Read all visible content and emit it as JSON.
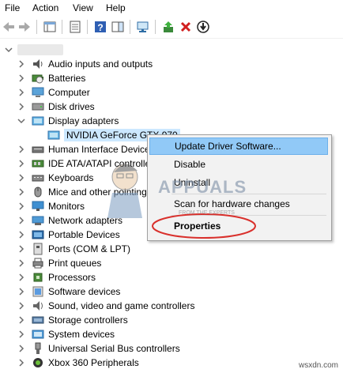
{
  "menu": [
    "File",
    "Action",
    "View",
    "Help"
  ],
  "toolbar_icons": [
    "back-arrow-icon",
    "forward-arrow-icon",
    "show-hide-console-icon",
    "properties-icon",
    "help-icon",
    "action-pane-icon",
    "scan-hardware-icon",
    "update-driver-icon",
    "uninstall-x-icon",
    "disable-device-icon"
  ],
  "tree": {
    "root_label": "",
    "items": [
      {
        "label": "Audio inputs and outputs",
        "icon": "speaker-icon",
        "expanded": false
      },
      {
        "label": "Batteries",
        "icon": "battery-icon",
        "expanded": false
      },
      {
        "label": "Computer",
        "icon": "computer-icon",
        "expanded": false
      },
      {
        "label": "Disk drives",
        "icon": "disk-drive-icon",
        "expanded": false
      },
      {
        "label": "Display adapters",
        "icon": "display-adapter-icon",
        "expanded": true
      },
      {
        "label": "NVIDIA GeForce GTX 970",
        "icon": "display-adapter-icon",
        "child": true
      },
      {
        "label": "Human Interface Device",
        "icon": "hid-icon",
        "expanded": false
      },
      {
        "label": "IDE ATA/ATAPI controlle",
        "icon": "ide-controller-icon",
        "expanded": false
      },
      {
        "label": "Keyboards",
        "icon": "keyboard-icon",
        "expanded": false
      },
      {
        "label": "Mice and other pointing",
        "icon": "mouse-icon",
        "expanded": false
      },
      {
        "label": "Monitors",
        "icon": "monitor-icon",
        "expanded": false
      },
      {
        "label": "Network adapters",
        "icon": "network-adapter-icon",
        "expanded": false
      },
      {
        "label": "Portable Devices",
        "icon": "portable-device-icon",
        "expanded": false
      },
      {
        "label": "Ports (COM & LPT)",
        "icon": "port-icon",
        "expanded": false
      },
      {
        "label": "Print queues",
        "icon": "printer-icon",
        "expanded": false
      },
      {
        "label": "Processors",
        "icon": "processor-icon",
        "expanded": false
      },
      {
        "label": "Software devices",
        "icon": "software-device-icon",
        "expanded": false
      },
      {
        "label": "Sound, video and game controllers",
        "icon": "sound-icon",
        "expanded": false
      },
      {
        "label": "Storage controllers",
        "icon": "storage-controller-icon",
        "expanded": false
      },
      {
        "label": "System devices",
        "icon": "system-device-icon",
        "expanded": false
      },
      {
        "label": "Universal Serial Bus controllers",
        "icon": "usb-icon",
        "expanded": false
      },
      {
        "label": "Xbox 360 Peripherals",
        "icon": "xbox-icon",
        "expanded": false
      }
    ]
  },
  "context_menu": {
    "items": [
      "Update Driver Software...",
      "Disable",
      "Uninstall",
      "Scan for hardware changes",
      "Properties"
    ],
    "highlighted": "Update Driver Software...",
    "circled": "Properties"
  },
  "watermark": {
    "brand": "APPUALS",
    "tagline": "FROM THE EXPERTS",
    "site": "wsxdn.com"
  },
  "colors": {
    "highlight": "#cce8ff",
    "menu_hover": "#91c9f7",
    "circle": "#d9302c",
    "chevron": "#6b6b6b"
  }
}
